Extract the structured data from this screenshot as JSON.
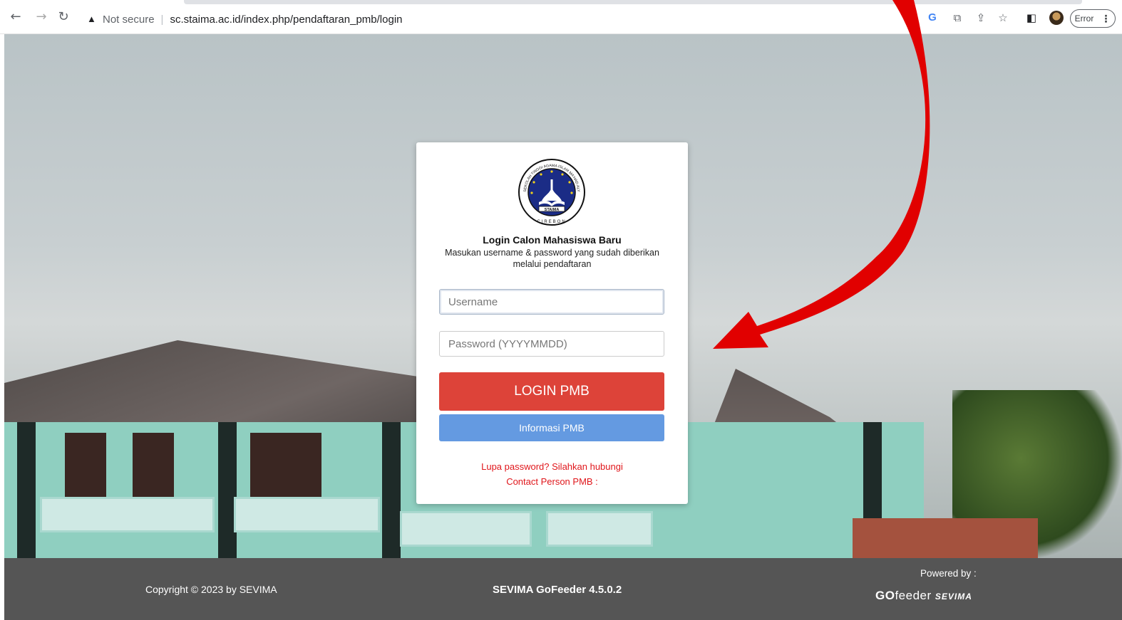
{
  "browser": {
    "not_secure": "Not secure",
    "url": "sc.staima.ac.id/index.php/pendaftaran_pmb/login",
    "error_label": "Error",
    "icons": [
      "back-icon",
      "forward-icon",
      "reload-icon",
      "warning-icon",
      "google-icon",
      "translate-icon",
      "share-icon",
      "star-icon",
      "sidepanel-icon",
      "profile-avatar",
      "more-vert-icon"
    ]
  },
  "login": {
    "title": "Login Calon Mahasiswa Baru",
    "subtitle": "Masukan username & password yang sudah diberikan melalui pendaftaran",
    "username_placeholder": "Username",
    "password_placeholder": "Password (YYYYMMDD)",
    "login_button": "LOGIN PMB",
    "info_button": "Informasi PMB",
    "forgot_line1": "Lupa password? Silahkan hubungi",
    "forgot_line2": "Contact Person PMB :",
    "logo_text_top": "SEKOLAH TINGGI AGAMA ISLAM MA'HAD ALY",
    "logo_text_band": "STAIMA",
    "logo_text_bottom": "CIREBON"
  },
  "footer": {
    "copyright": "Copyright © 2023 by SEVIMA",
    "product": "SEVIMA GoFeeder 4.5.0.2",
    "powered_by": "Powered by :",
    "brand_go": "GO",
    "brand_feeder": "feeder",
    "brand_sevima": "SEVIMA"
  },
  "colors": {
    "login_button": "#dd4339",
    "info_button": "#649ae1",
    "forgot_text": "#e0161b",
    "footer_bg": "#555555",
    "annotation_arrow": "#e10000"
  }
}
